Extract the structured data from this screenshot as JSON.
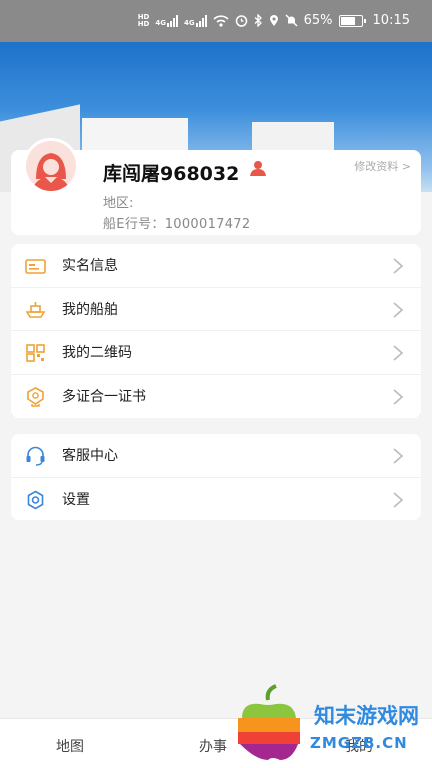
{
  "status_bar": {
    "hd1": "HD",
    "hd2": "HD",
    "net1": "4G",
    "net2": "4G",
    "battery_text": "65%",
    "battery_level": 0.65,
    "time": "10:15"
  },
  "profile": {
    "username": "库闯屠968032",
    "edit_label": "修改资料 >",
    "region_label": "地区:",
    "ship_id": "船E行号：1000017472"
  },
  "menu_main": [
    {
      "label": "实名信息",
      "icon": "id-card-icon"
    },
    {
      "label": "我的船舶",
      "icon": "ship-icon"
    },
    {
      "label": "我的二维码",
      "icon": "qr-code-icon"
    },
    {
      "label": "多证合一证书",
      "icon": "certificate-icon"
    }
  ],
  "menu_secondary": [
    {
      "label": "客服中心",
      "icon": "headset-icon"
    },
    {
      "label": "设置",
      "icon": "gear-icon"
    }
  ],
  "tab_bar": {
    "map": "地图",
    "work": "办事",
    "mine": "我的"
  },
  "watermark": {
    "title": "知末游戏网",
    "url": "ZMGZB.CN"
  },
  "colors": {
    "accent_orange": "#f0a237",
    "accent_blue": "#3a86d8",
    "avatar_red": "#e8574a"
  }
}
